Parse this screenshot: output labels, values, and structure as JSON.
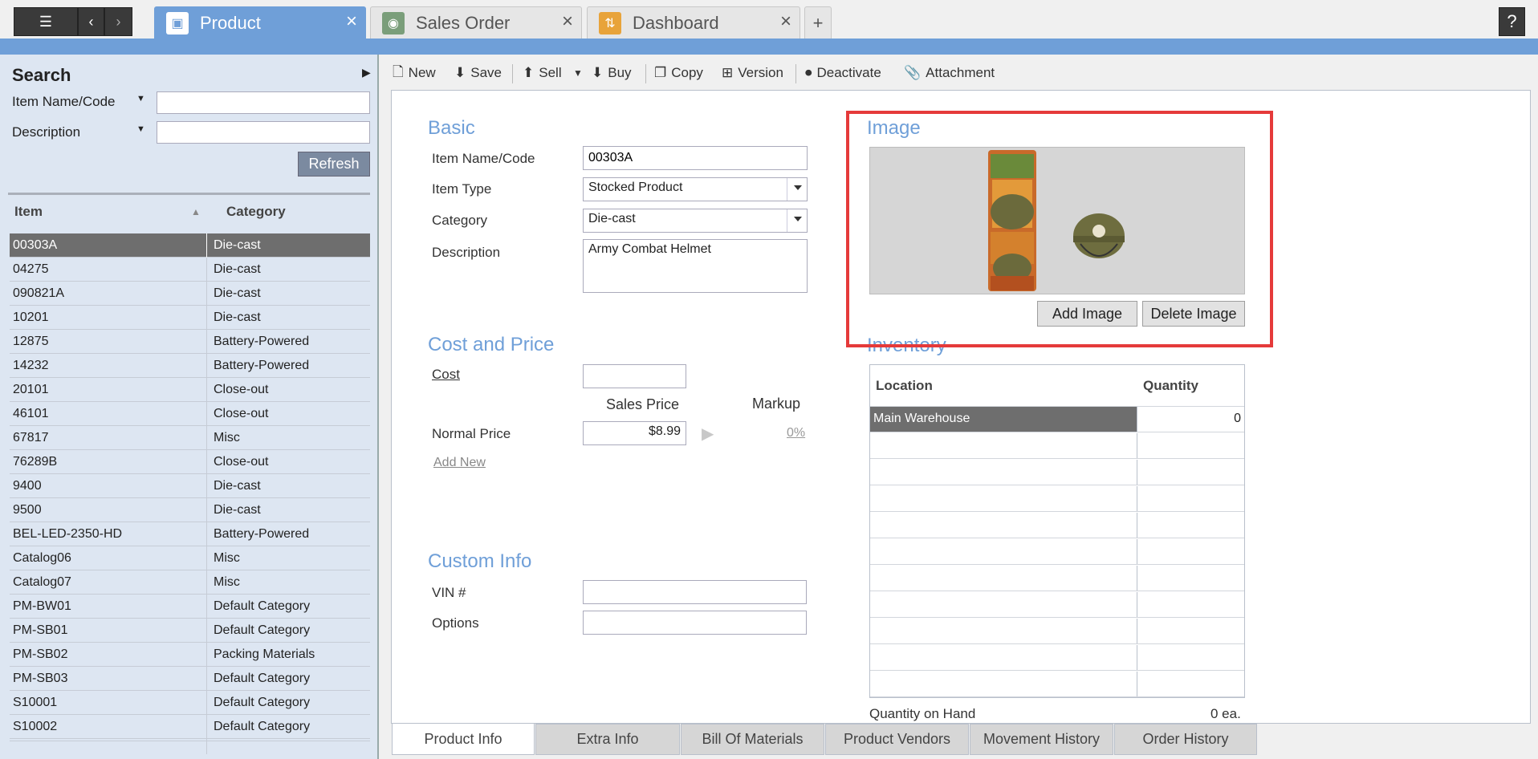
{
  "tabs": [
    {
      "label": "Product",
      "icon": "product-icon"
    },
    {
      "label": "Sales Order",
      "icon": "sales-order-icon"
    },
    {
      "label": "Dashboard",
      "icon": "dashboard-icon"
    }
  ],
  "help_label": "?",
  "search": {
    "title": "Search",
    "field1_label": "Item Name/Code",
    "field2_label": "Description",
    "field1_value": "",
    "field2_value": "",
    "refresh_label": "Refresh"
  },
  "grid": {
    "col1": "Item",
    "col2": "Category",
    "rows": [
      [
        "00303A",
        "Die-cast"
      ],
      [
        "04275",
        "Die-cast"
      ],
      [
        "090821A",
        "Die-cast"
      ],
      [
        "10201",
        "Die-cast"
      ],
      [
        "12875",
        "Battery-Powered"
      ],
      [
        "14232",
        "Battery-Powered"
      ],
      [
        "20101",
        "Close-out"
      ],
      [
        "46101",
        "Close-out"
      ],
      [
        "67817",
        "Misc"
      ],
      [
        "76289B",
        "Close-out"
      ],
      [
        "9400",
        "Die-cast"
      ],
      [
        "9500",
        "Die-cast"
      ],
      [
        "BEL-LED-2350-HD",
        "Battery-Powered"
      ],
      [
        "Catalog06",
        "Misc"
      ],
      [
        "Catalog07",
        "Misc"
      ],
      [
        "PM-BW01",
        "Default Category"
      ],
      [
        "PM-SB01",
        "Default Category"
      ],
      [
        "PM-SB02",
        "Packing Materials"
      ],
      [
        "PM-SB03",
        "Default Category"
      ],
      [
        "S10001",
        "Default Category"
      ],
      [
        "S10002",
        "Default Category"
      ]
    ]
  },
  "toolbar": {
    "new": "New",
    "save": "Save",
    "sell": "Sell",
    "buy": "Buy",
    "copy": "Copy",
    "version": "Version",
    "deactivate": "Deactivate",
    "attachment": "Attachment"
  },
  "basic": {
    "title": "Basic",
    "item_name_label": "Item Name/Code",
    "item_name_value": "00303A",
    "item_type_label": "Item Type",
    "item_type_value": "Stocked Product",
    "category_label": "Category",
    "category_value": "Die-cast",
    "description_label": "Description",
    "description_value": "Army Combat Helmet"
  },
  "cost_price": {
    "title": "Cost and Price",
    "cost_label": "Cost",
    "cost_value": "",
    "sales_price_header": "Sales Price",
    "markup_header": "Markup",
    "normal_price_label": "Normal Price",
    "normal_price_value": "$8.99",
    "markup_value": "0%",
    "add_new_label": "Add New"
  },
  "custom_info": {
    "title": "Custom Info",
    "vin_label": "VIN #",
    "vin_value": "",
    "options_label": "Options",
    "options_value": ""
  },
  "image": {
    "title": "Image",
    "add_label": "Add Image",
    "delete_label": "Delete Image"
  },
  "inventory": {
    "title": "Inventory",
    "col_location": "Location",
    "col_quantity": "Quantity",
    "rows": [
      [
        "Main Warehouse",
        "0"
      ]
    ],
    "qoh_label": "Quantity on Hand",
    "qoh_value": "0 ea."
  },
  "bottom_tabs": [
    "Product Info",
    "Extra Info",
    "Bill Of Materials",
    "Product Vendors",
    "Movement History",
    "Order History"
  ],
  "colors": {
    "accent": "#6f9fd8",
    "highlight": "#e53a3a",
    "selected_row": "#6e6e6e"
  }
}
